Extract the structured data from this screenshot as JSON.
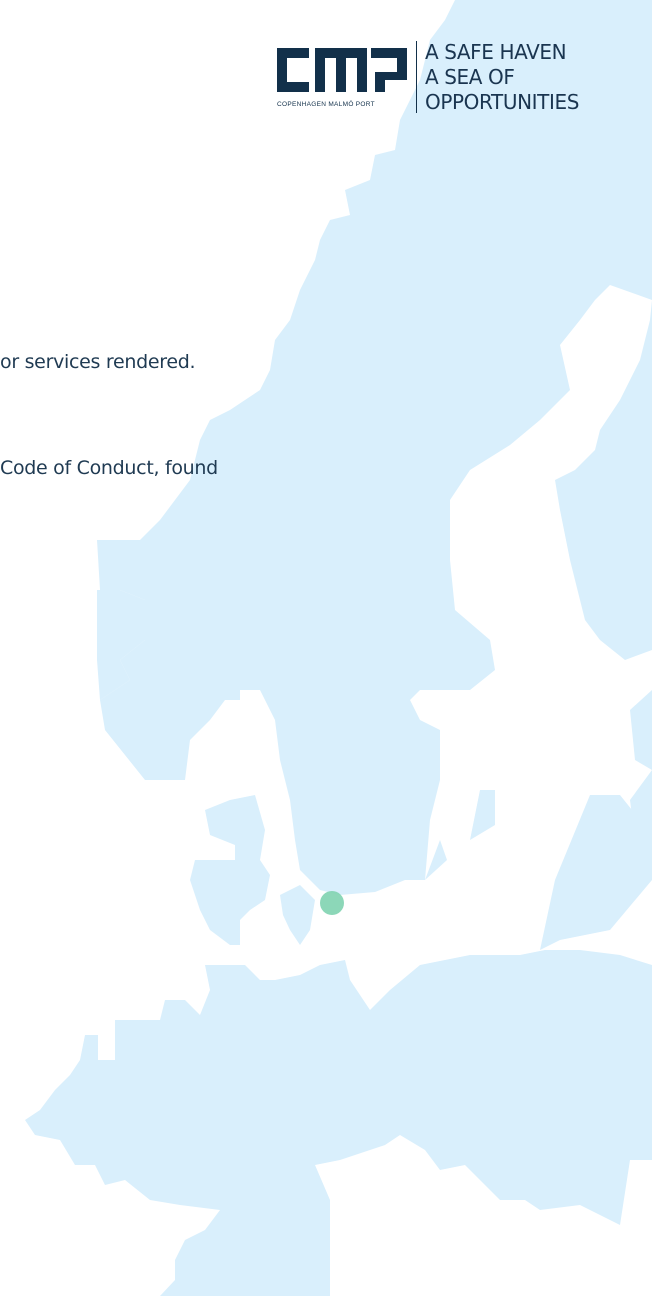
{
  "brand": {
    "caption": "COPENHAGEN MALMÖ PORT",
    "tagline": [
      "A SAFE HAVEN",
      "A SEA OF",
      "OPPORTUNITIES"
    ],
    "color": "#12304a"
  },
  "content": {
    "line1": "or services rendered.",
    "line2": "Code of Conduct, found"
  },
  "map": {
    "land_color": "#d9effc",
    "marker_color": "#7fd3b0",
    "marker_label": "location-marker"
  }
}
